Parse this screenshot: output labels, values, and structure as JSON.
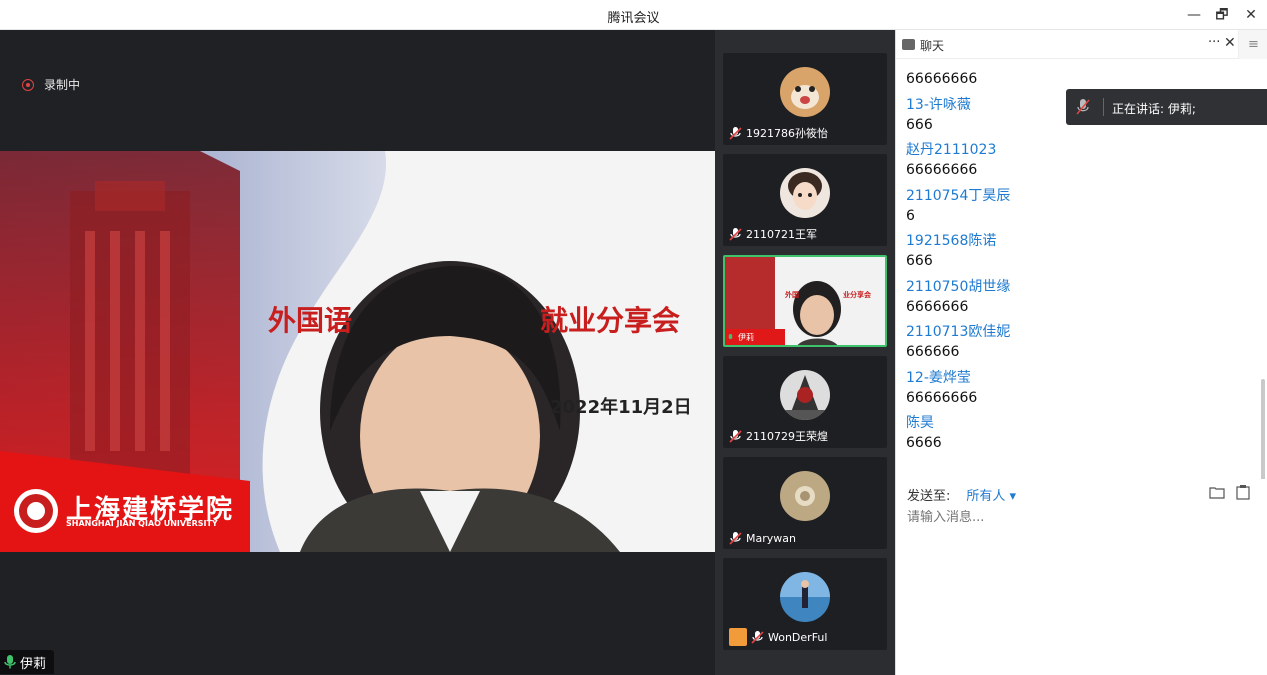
{
  "window": {
    "title": "腾讯会议",
    "minimize": "—",
    "restore": "🗗",
    "close": "✕"
  },
  "recording": {
    "label": "录制中"
  },
  "slide": {
    "title_left": "外国语",
    "title_right": "就业分享会",
    "date": "2022年11月2日",
    "school_cn": "上海建桥学院",
    "school_en": "SHANGHAI JIAN QIAO UNIVERSITY"
  },
  "active_speaker": {
    "name": "伊莉"
  },
  "participants": [
    {
      "name": "1921786孙筱怡",
      "avatar": "dog-avatar",
      "muted": true
    },
    {
      "name": "2110721王军",
      "avatar": "child-avatar",
      "muted": true
    },
    {
      "name": "伊莉",
      "avatar": "video",
      "muted": false,
      "active": true
    },
    {
      "name": "2110729王荣煌",
      "avatar": "knight-avatar",
      "muted": true
    },
    {
      "name": "Marywan",
      "avatar": "shell-avatar",
      "muted": true
    },
    {
      "name": "WonDerFul",
      "avatar": "seaside-avatar",
      "muted": true
    }
  ],
  "chat": {
    "title": "聊天",
    "more": "···",
    "close": "✕",
    "menu": "≡",
    "speaking_label": "正在讲话: 伊莉;",
    "messages": [
      {
        "type": "text",
        "value": "66666666"
      },
      {
        "type": "name",
        "value": "13-许咏薇"
      },
      {
        "type": "text",
        "value": "666"
      },
      {
        "type": "name",
        "value": "赵丹2111023"
      },
      {
        "type": "text",
        "value": "66666666"
      },
      {
        "type": "name",
        "value": "2110754丁昊辰"
      },
      {
        "type": "text",
        "value": "6"
      },
      {
        "type": "name",
        "value": "1921568陈诺"
      },
      {
        "type": "text",
        "value": "666"
      },
      {
        "type": "name",
        "value": "2110750胡世缘"
      },
      {
        "type": "text",
        "value": "6666666"
      },
      {
        "type": "name",
        "value": "2110713欧佳妮"
      },
      {
        "type": "text",
        "value": "666666"
      },
      {
        "type": "name",
        "value": "12-姜烨莹"
      },
      {
        "type": "text",
        "value": "66666666"
      },
      {
        "type": "name",
        "value": "陈昊"
      },
      {
        "type": "text",
        "value": "6666"
      }
    ],
    "send_label": "发送至:",
    "send_target": "所有人 ▾",
    "input_placeholder": "请输入消息..."
  },
  "colors": {
    "accent_blue": "#1f7bd1",
    "brand_red": "#c81e1e",
    "active_green": "#3ec26b"
  }
}
